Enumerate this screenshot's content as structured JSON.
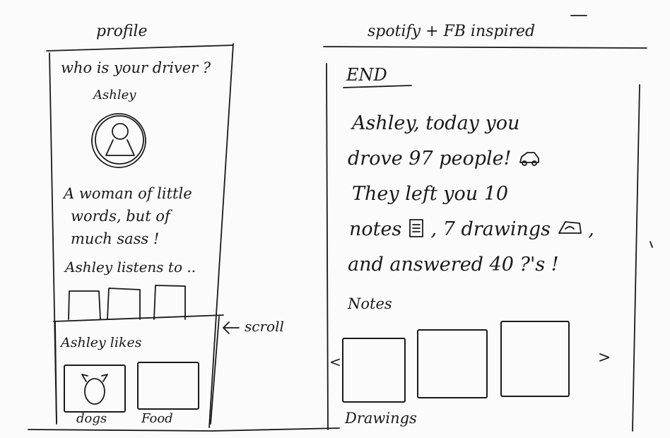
{
  "left_panel": {
    "caption": "profile",
    "question": "who is your driver ?",
    "name": "Ashley",
    "bio_lines": [
      "A woman of little",
      "words, but of",
      "much sass !"
    ],
    "listens_to": "Ashley listens to ..",
    "scroll_hint": "scroll",
    "likes": {
      "heading": "Ashley likes",
      "items": [
        {
          "label": "dogs",
          "icon": "dog-icon"
        },
        {
          "label": "Food",
          "icon": "food-icon"
        }
      ]
    }
  },
  "right_panel": {
    "caption": "spotify + FB inspired",
    "end_label": "END",
    "summary_lines": [
      "Ashley, today you",
      "drove 97 people!",
      "They left you 10",
      "notes",
      ", 7 drawings",
      ",",
      "and answered 40 ?'s !"
    ],
    "notes_heading": "Notes",
    "prev_arrow": "<",
    "next_arrow": ">",
    "drawings_heading": "Drawings"
  },
  "icons": {
    "car": "car-icon",
    "notes": "note-icon",
    "drawing": "drawing-icon",
    "scroll_arrow": "arrow-left-icon"
  }
}
